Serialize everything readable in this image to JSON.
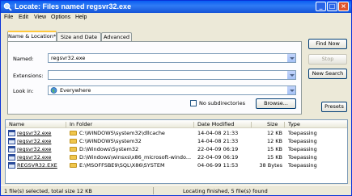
{
  "window": {
    "title": "Locate: Files named regsvr32.exe"
  },
  "menu": [
    "File",
    "Edit",
    "View",
    "Options",
    "Help"
  ],
  "tabs": [
    "Name & Location*",
    "Size and Date",
    "Advanced"
  ],
  "form": {
    "named_label": "Named:",
    "named_value": "regsvr32.exe",
    "extensions_label": "Extensions:",
    "extensions_value": "",
    "lookin_label": "Look in:",
    "lookin_value": "Everywhere",
    "no_subdirs_label": "No subdirectories",
    "no_subdirs_checked": false,
    "browse_label": "Browse..."
  },
  "buttons": {
    "find_now": "Find Now",
    "stop": "Stop",
    "new_search": "New Search",
    "presets": "Presets"
  },
  "results": {
    "columns": [
      "Name",
      "In Folder",
      "Date Modified",
      "Size",
      "Type"
    ],
    "rows": [
      {
        "name": "regsvr32.exe",
        "folder": "C:\\WINDOWS\\system32\\dllcache",
        "date": "14-04-08 21:33",
        "size": "12 KB",
        "type": "Toepassing"
      },
      {
        "name": "regsvr32.exe",
        "folder": "C:\\WINDOWS\\system32",
        "date": "14-04-08 21:33",
        "size": "12 KB",
        "type": "Toepassing"
      },
      {
        "name": "regsvr32.exe",
        "folder": "D:\\Windows\\System32",
        "date": "22-04-09 06:19",
        "size": "15 KB",
        "type": "Toepassing"
      },
      {
        "name": "regsvr32.exe",
        "folder": "D:\\Windows\\winsxs\\x86_microsoft-windo...",
        "date": "22-04-09 06:19",
        "size": "15 KB",
        "type": "Toepassing"
      },
      {
        "name": "REGSVR32.EXE",
        "folder": "E:\\MSOFFSBE9\\SQL\\X86\\SYSTEM",
        "date": "04-06-99 11:53",
        "size": "38 Bytes",
        "type": "Toepassing"
      }
    ]
  },
  "status": {
    "left": "1 file(s) selected, total size 12 KB",
    "right": "Locating finished, 5 file(s) found"
  }
}
